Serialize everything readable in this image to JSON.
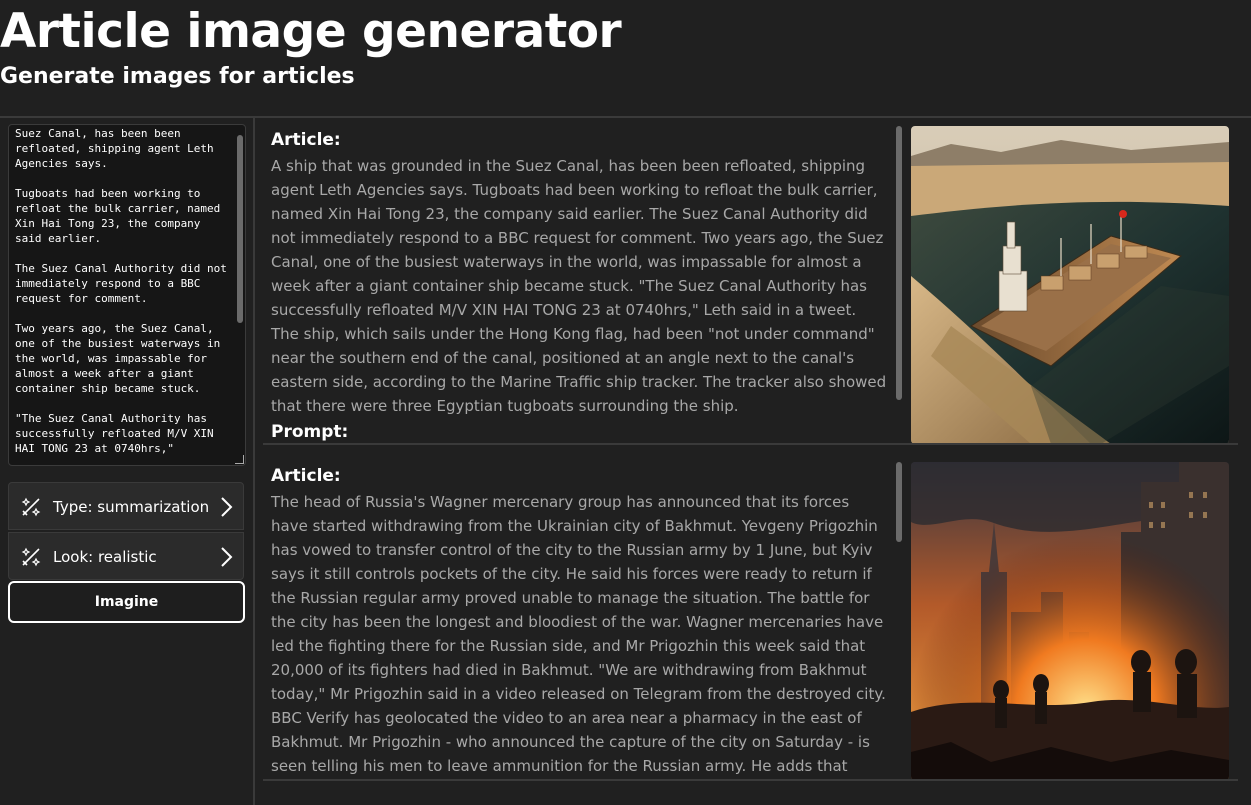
{
  "header": {
    "title": "Article image generator",
    "subtitle": "Generate images for articles"
  },
  "sidebar": {
    "article_input_value": "A ship that was grounded in the Suez Canal, has been been refloated, shipping agent Leth Agencies says.\n\nTugboats had been working to refloat the bulk carrier, named Xin Hai Tong 23, the company said earlier.\n\nThe Suez Canal Authority did not immediately respond to a BBC request for comment.\n\nTwo years ago, the Suez Canal, one of the busiest waterways in the world, was impassable for almost a week after a giant container ship became stuck.\n\n\"The Suez Canal Authority has successfully refloated M/V XIN HAI TONG 23 at 0740hrs,\"",
    "type_option": "Type: summarization",
    "look_option": "Look: realistic",
    "imagine_label": "Imagine"
  },
  "results": [
    {
      "article_heading": "Article:",
      "article_text": "A ship that was grounded in the Suez Canal, has been been refloated, shipping agent Leth Agencies says. Tugboats had been working to refloat the bulk carrier, named Xin Hai Tong 23, the company said earlier. The Suez Canal Authority did not immediately respond to a BBC request for comment. Two years ago, the Suez Canal, one of the busiest waterways in the world, was impassable for almost a week after a giant container ship became stuck. \"The Suez Canal Authority has successfully refloated M/V XIN HAI TONG 23 at 0740hrs,\" Leth said in a tweet. The ship, which sails under the Hong Kong flag, had been \"not under command\" near the southern end of the canal, positioned at an angle next to the canal's eastern side, according to the Marine Traffic ship tracker. The tracker also showed that there were three Egyptian tugboats surrounding the ship.",
      "prompt_heading": "Prompt:",
      "image_icon": "cargo-ship-image"
    },
    {
      "article_heading": "Article:",
      "article_text": "The head of Russia's Wagner mercenary group has announced that its forces have started withdrawing from the Ukrainian city of Bakhmut. Yevgeny Prigozhin has vowed to transfer control of the city to the Russian army by 1 June, but Kyiv says it still controls pockets of the city. He said his forces were ready to return if the Russian regular army proved unable to manage the situation. The battle for the city has been the longest and bloodiest of the war. Wagner mercenaries have led the fighting there for the Russian side, and Mr Prigozhin this week said that 20,000 of its fighters had died in Bakhmut. \"We are withdrawing from Bakhmut today,\" Mr Prigozhin said in a video released on Telegram from the destroyed city. BBC Verify has geolocated the video to an area near a pharmacy in the east of Bakhmut. Mr Prigozhin - who announced the capture of the city on Saturday - is seen telling his men to leave ammunition for the Russian army. He adds that some Wagner fighters",
      "image_icon": "burning-city-image"
    }
  ],
  "colors": {
    "background": "#202020",
    "input_background": "#161616",
    "option_background": "#2b2b2b",
    "body_text": "#a8a8a8"
  }
}
